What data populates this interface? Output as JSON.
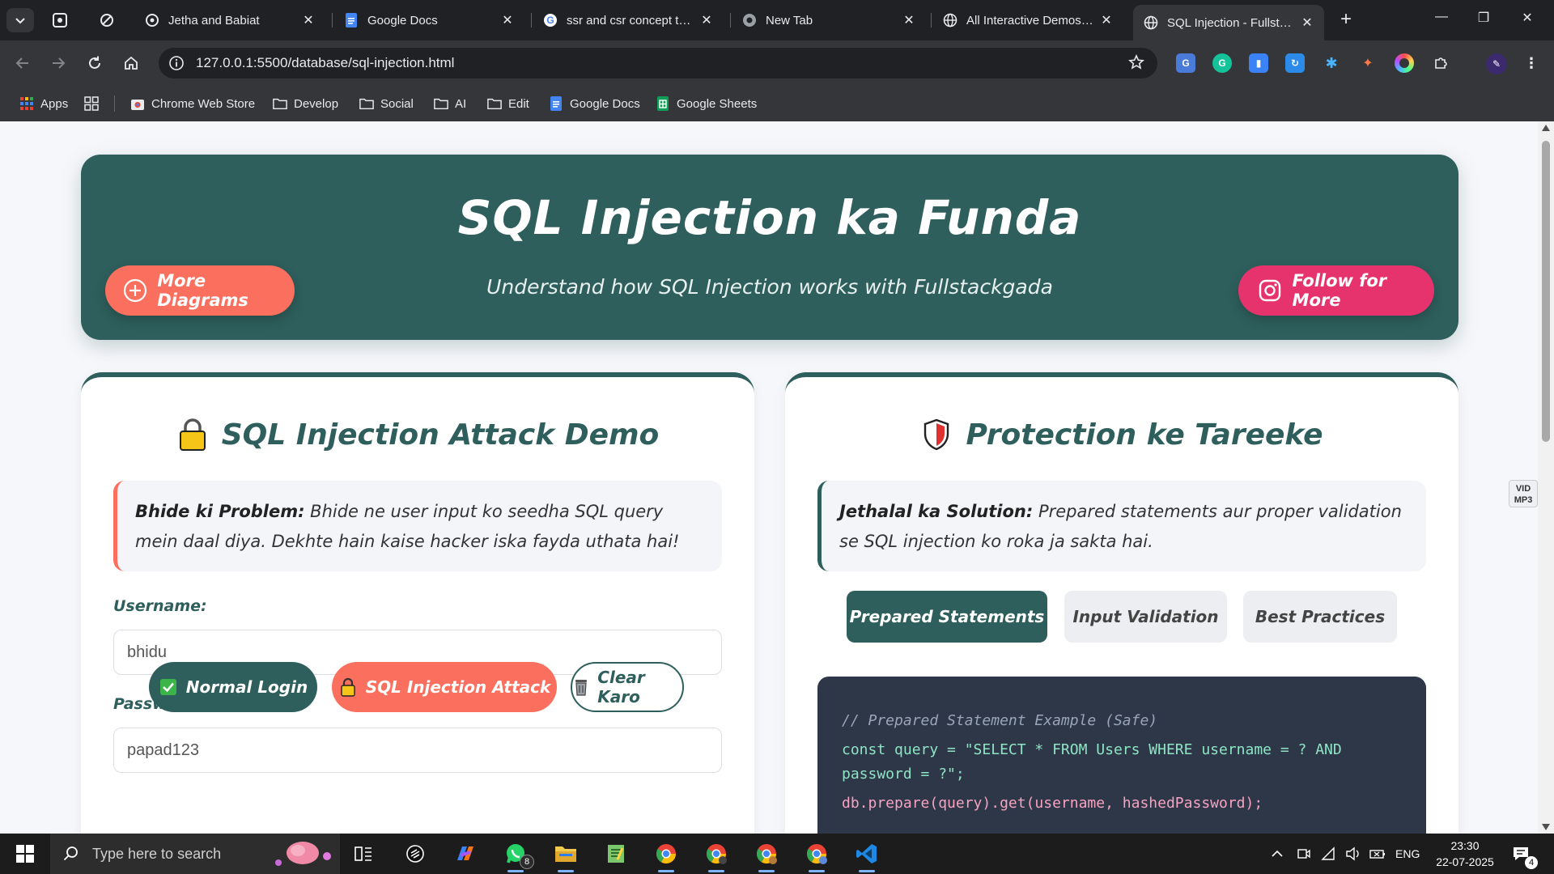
{
  "browser": {
    "tabs": [
      {
        "label": "Jetha and Babiat"
      },
      {
        "label": "Google Docs"
      },
      {
        "label": "ssr and csr concept to le"
      },
      {
        "label": "New Tab"
      },
      {
        "label": "All Interactive Demos | F"
      },
      {
        "label": "SQL Injection - Fullstack"
      }
    ],
    "url": "127.0.0.1:5500/database/sql-injection.html",
    "bookmarks": [
      {
        "label": "Apps"
      },
      {
        "label": "Chrome Web Store"
      },
      {
        "label": "Develop"
      },
      {
        "label": "Social"
      },
      {
        "label": "AI"
      },
      {
        "label": "Edit"
      },
      {
        "label": "Google Docs"
      },
      {
        "label": "Google Sheets"
      }
    ]
  },
  "hero": {
    "title": "SQL Injection ka Funda",
    "subtitle": "Understand how SQL Injection works with Fullstackgada",
    "more_label": "More Diagrams",
    "follow_label": "Follow for More"
  },
  "attack": {
    "title": "SQL Injection Attack Demo",
    "note_bold": "Bhide ki Problem:",
    "note_text": " Bhide ne user input ko seedha SQL query mein daal diya. Dekhte hain kaise hacker iska fayda uthata hai!",
    "username_label": "Username:",
    "username_value": "bhidu",
    "password_label": "Password:",
    "password_value": "papad123",
    "btn_normal": "Normal Login",
    "btn_attack": "SQL Injection Attack",
    "btn_clear": "Clear Karo"
  },
  "protection": {
    "title": "Protection ke Tareeke",
    "note_bold": "Jethalal ka Solution:",
    "note_text": " Prepared statements aur proper validation se SQL injection ko roka ja sakta hai.",
    "tabs": [
      {
        "label": "Prepared Statements"
      },
      {
        "label": "Input Validation"
      },
      {
        "label": "Best Practices"
      }
    ],
    "code_comment": "// Prepared Statement Example (Safe)",
    "code_line1": "const query = \"SELECT * FROM Users WHERE username = ? AND password = ?\";",
    "code_line2": "db.prepare(query).get(username, hashedPassword);"
  },
  "side_badge": {
    "line1": "VID",
    "line2": "MP3"
  },
  "taskbar": {
    "search_placeholder": "Type here to search",
    "whatsapp_badge": "8",
    "lang": "ENG",
    "time": "23:30",
    "date": "22-07-2025",
    "notif_count": "4"
  },
  "colors": {
    "teal": "#2e5f5c",
    "coral": "#fa6f5e",
    "pink": "#e6336d",
    "code_bg": "#2d3748"
  }
}
